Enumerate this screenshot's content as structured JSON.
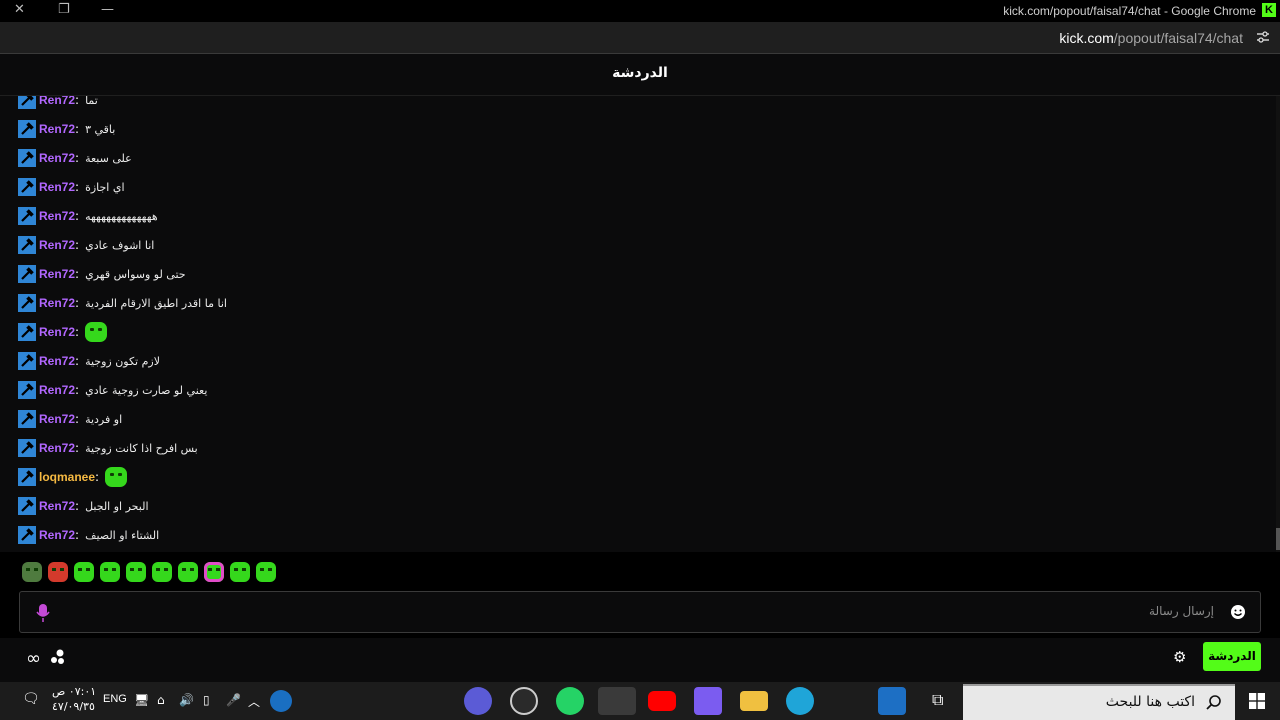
{
  "window": {
    "title": "kick.com/popout/faisal74/chat - Google Chrome",
    "close": "✕",
    "restore": "❐",
    "minimize": "—"
  },
  "addressbar": {
    "domain": "kick.com",
    "path": "/popout/faisal74/chat"
  },
  "chat": {
    "title": "الدردشة",
    "messages": [
      {
        "user": "Ren72",
        "text": "تما",
        "emote": false,
        "color": "#b267ff"
      },
      {
        "user": "Ren72",
        "text": "باقي ٣",
        "emote": false,
        "color": "#b267ff"
      },
      {
        "user": "Ren72",
        "text": "على سبعة",
        "emote": false,
        "color": "#b267ff"
      },
      {
        "user": "Ren72",
        "text": "اي اجازة",
        "emote": false,
        "color": "#b267ff"
      },
      {
        "user": "Ren72",
        "text": "هههههههههههههه",
        "emote": false,
        "color": "#b267ff"
      },
      {
        "user": "Ren72",
        "text": "انا اشوف عادي",
        "emote": false,
        "color": "#b267ff"
      },
      {
        "user": "Ren72",
        "text": "حتى لو وسواس قهري",
        "emote": false,
        "color": "#b267ff"
      },
      {
        "user": "Ren72",
        "text": "انا ما اقدر اطيق الارقام الفردية",
        "emote": false,
        "color": "#b267ff"
      },
      {
        "user": "Ren72",
        "text": "",
        "emote": true,
        "color": "#b267ff"
      },
      {
        "user": "Ren72",
        "text": "لازم تكون زوجية",
        "emote": false,
        "color": "#b267ff"
      },
      {
        "user": "Ren72",
        "text": "يعني لو صارت زوجية عادي",
        "emote": false,
        "color": "#b267ff"
      },
      {
        "user": "Ren72",
        "text": "او فردية",
        "emote": false,
        "color": "#b267ff"
      },
      {
        "user": "Ren72",
        "text": "بس افرح اذا كانت زوجية",
        "emote": false,
        "color": "#b267ff"
      },
      {
        "user": "loqmanee",
        "text": "",
        "emote": true,
        "color": "#f5b942"
      },
      {
        "user": "Ren72",
        "text": "البحر او الجبل",
        "emote": false,
        "color": "#b267ff"
      },
      {
        "user": "Ren72",
        "text": "الشتاء او الصيف",
        "emote": false,
        "color": "#b267ff"
      }
    ],
    "input_placeholder": "إرسال رسالة",
    "send_tab_label": "الدردشة"
  },
  "taskbar": {
    "time": "٠٧:٠١ ص",
    "date": "٤٧/٠٩/٣٥",
    "language": "ENG",
    "search_placeholder": "اكتب هنا للبحث"
  }
}
